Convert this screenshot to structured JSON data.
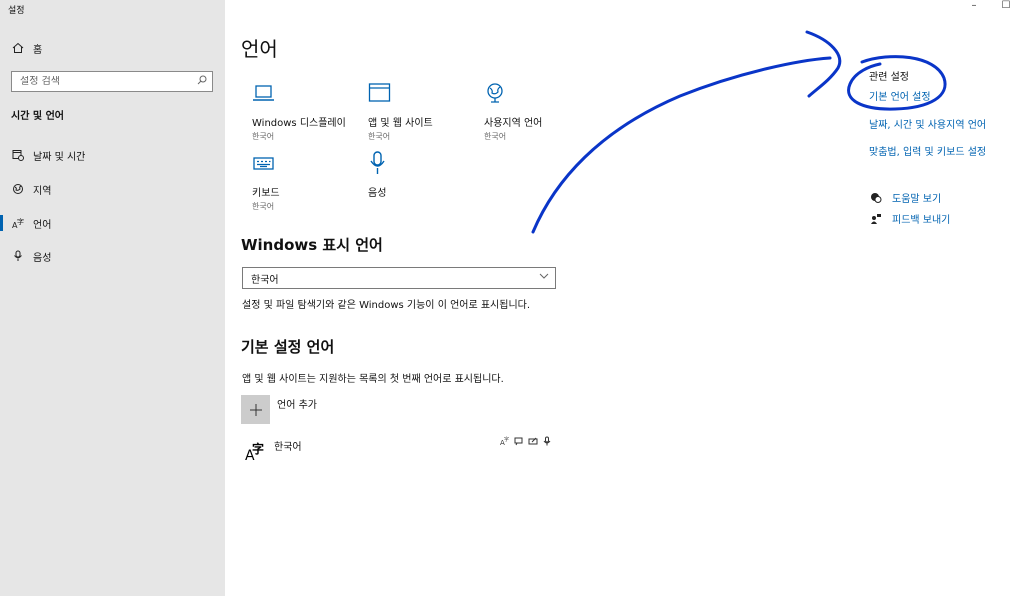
{
  "window": {
    "title": "설정",
    "minimize": "–",
    "maximize": "☐"
  },
  "sidebar": {
    "home_label": "홈",
    "search_placeholder": "설정 검색",
    "section_title": "시간 및 언어",
    "items": [
      {
        "label": "날짜 및 시간",
        "icon": "calendar-clock-icon"
      },
      {
        "label": "지역",
        "icon": "globe-icon"
      },
      {
        "label": "언어",
        "icon": "language-icon",
        "active": true
      },
      {
        "label": "음성",
        "icon": "microphone-icon"
      }
    ]
  },
  "main": {
    "title": "언어",
    "tiles": [
      {
        "name": "Windows 디스플레이",
        "sub": "한국어",
        "icon": "laptop-icon"
      },
      {
        "name": "앱 및 웹 사이트",
        "sub": "한국어",
        "icon": "window-icon"
      },
      {
        "name": "사용지역 언어",
        "sub": "한국어",
        "icon": "globe-pin-icon"
      },
      {
        "name": "키보드",
        "sub": "한국어",
        "icon": "keyboard-icon"
      },
      {
        "name": "음성",
        "sub": "",
        "icon": "microphone-icon"
      }
    ],
    "display_language": {
      "heading": "Windows 표시 언어",
      "selected": "한국어",
      "description": "설정 및 파일 탐색기와 같은 Windows 기능이 이 언어로 표시됩니다."
    },
    "preferred_languages": {
      "heading": "기본 설정 언어",
      "description": "앱 및 웹 사이트는 지원하는 목록의 첫 번째 언어로 표시됩니다.",
      "add_label": "언어 추가",
      "languages": [
        {
          "name": "한국어",
          "icon_glyph": "字",
          "icon_letter": "A"
        }
      ]
    }
  },
  "related": {
    "title": "관련 설정",
    "links": [
      "기본 언어 설정",
      "날짜, 시간 및 사용지역 언어",
      "맞춤법, 입력 및 키보드 설정"
    ],
    "help": "도움말 보기",
    "feedback": "피드백 보내기"
  },
  "colors": {
    "accent": "#0063b1",
    "annotation": "#0a35c8",
    "sidebar_bg": "#e6e6e6"
  }
}
